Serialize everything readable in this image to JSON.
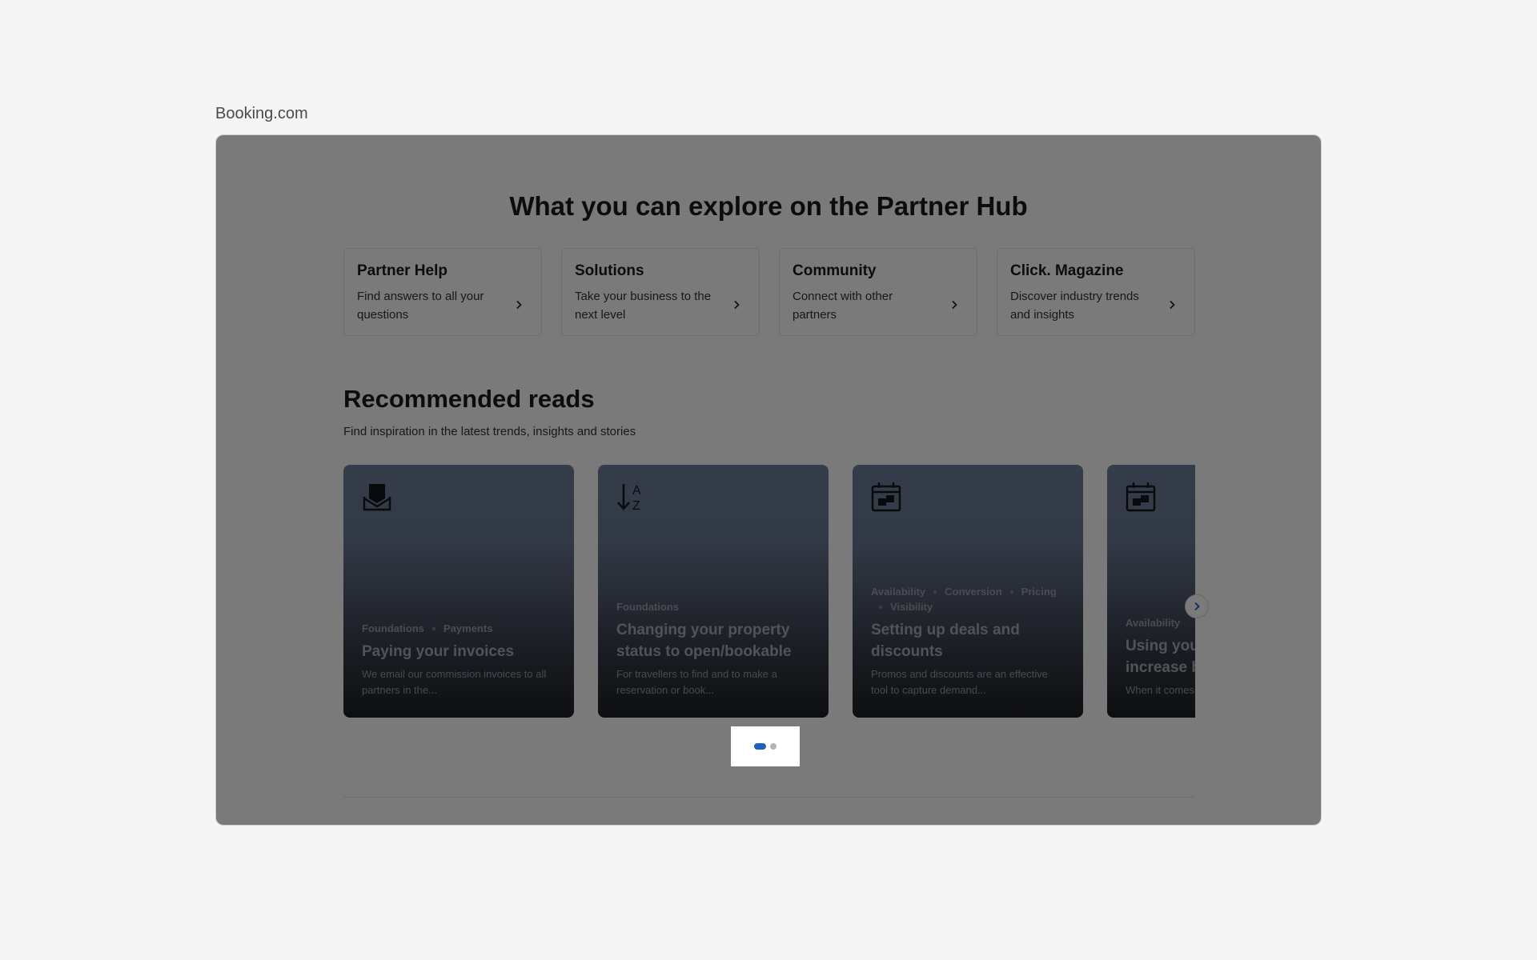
{
  "site": {
    "label": "Booking.com"
  },
  "hero": {
    "title": "What you can explore on the Partner Hub"
  },
  "hub_cards": [
    {
      "title": "Partner Help",
      "desc": "Find answers to all your questions",
      "icon": "chevron-right-icon"
    },
    {
      "title": "Solutions",
      "desc": "Take your business to the next level",
      "icon": "chevron-right-icon"
    },
    {
      "title": "Community",
      "desc": "Connect with other partners",
      "icon": "chevron-right-icon"
    },
    {
      "title": "Click. Magazine",
      "desc": "Discover industry trends and insights",
      "icon": "chevron-right-icon"
    }
  ],
  "reads": {
    "title": "Recommended reads",
    "subtitle": "Find inspiration in the latest trends, insights and stories",
    "cards": [
      {
        "icon": "inbox-icon",
        "tags": [
          "Foundations",
          "Payments"
        ],
        "title": "Paying your invoices",
        "desc": "We email our commission invoices to all partners in the..."
      },
      {
        "icon": "sort-az-icon",
        "tags": [
          "Foundations"
        ],
        "title": "Changing your property status to open/bookable",
        "desc": "For travellers to find and to make a reservation or book..."
      },
      {
        "icon": "calendar-icon",
        "tags": [
          "Availability",
          "Conversion",
          "Pricing",
          "Visibility"
        ],
        "title": "Setting up deals and discounts",
        "desc": "Promos and discounts are an effective tool to capture demand..."
      },
      {
        "icon": "calendar-icon",
        "tags": [
          "Availability"
        ],
        "title": "Using your rate plans to increase b",
        "desc": "When it comes to the number of gue"
      }
    ]
  },
  "pager": {
    "active_index": 0,
    "count": 2
  },
  "colors": {
    "accent": "#1f5fbf",
    "overlay": "rgba(0,0,0,0.52)",
    "card_gradient_top": "#6f7f9b",
    "card_gradient_bottom": "#1d1f24"
  }
}
